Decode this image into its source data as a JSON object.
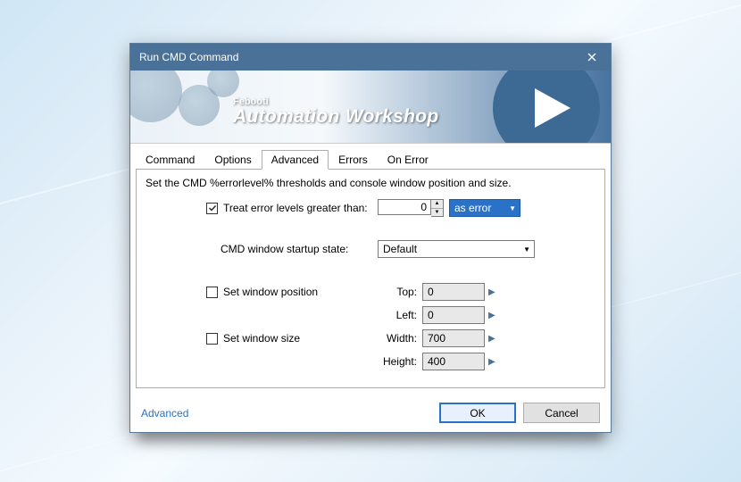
{
  "titlebar": {
    "title": "Run CMD Command"
  },
  "banner": {
    "brand_small": "Febooti",
    "brand_large": "Automation Workshop"
  },
  "tabs": [
    "Command",
    "Options",
    "Advanced",
    "Errors",
    "On Error"
  ],
  "active_tab": 2,
  "panel": {
    "description": "Set the CMD %errorlevel% thresholds and console window position and size.",
    "treat_error": {
      "checked": true,
      "label": "Treat error levels greater than:",
      "value": "0",
      "as": {
        "selected": "as error"
      }
    },
    "startup": {
      "label": "CMD window startup state:",
      "selected": "Default"
    },
    "position": {
      "enabled": false,
      "label": "Set window position",
      "top_label": "Top:",
      "top": "0",
      "left_label": "Left:",
      "left": "0"
    },
    "size": {
      "enabled": false,
      "label": "Set window size",
      "width_label": "Width:",
      "width": "700",
      "height_label": "Height:",
      "height": "400"
    }
  },
  "footer": {
    "link": "Advanced",
    "ok": "OK",
    "cancel": "Cancel"
  }
}
